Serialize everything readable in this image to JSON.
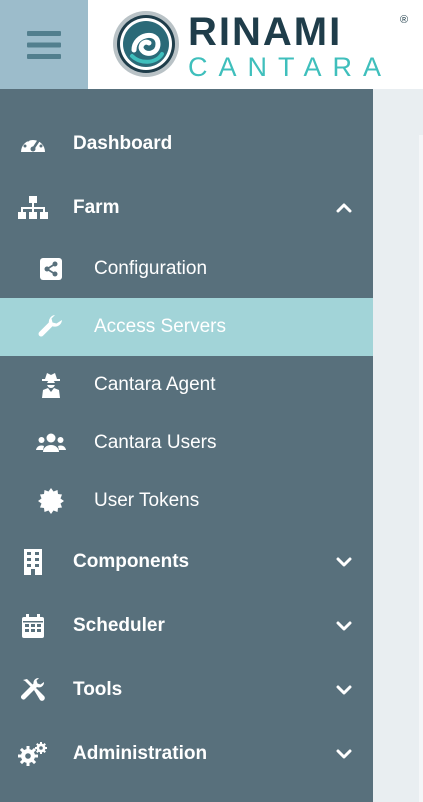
{
  "header": {
    "logo_line1": "RINAMI",
    "logo_reg": "®",
    "logo_line2": "CANTARA"
  },
  "sidebar": {
    "items": [
      {
        "label": "Dashboard",
        "icon": "gauge-icon"
      },
      {
        "label": "Farm",
        "icon": "sitemap-icon",
        "expanded": true
      },
      {
        "label": "Configuration",
        "icon": "share-icon"
      },
      {
        "label": "Access Servers",
        "icon": "wrench-icon",
        "active": true
      },
      {
        "label": "Cantara Agent",
        "icon": "user-secret-icon"
      },
      {
        "label": "Cantara Users",
        "icon": "users-icon"
      },
      {
        "label": "User Tokens",
        "icon": "certificate-icon"
      },
      {
        "label": "Components",
        "icon": "building-icon",
        "expanded": false
      },
      {
        "label": "Scheduler",
        "icon": "calendar-icon",
        "expanded": false
      },
      {
        "label": "Tools",
        "icon": "tools-icon",
        "expanded": false
      },
      {
        "label": "Administration",
        "icon": "cogs-icon",
        "expanded": false
      }
    ]
  },
  "colors": {
    "sidebar_bg": "#58707c",
    "active_bg": "#a2d4d8",
    "hamburger_bg": "#9cbccb",
    "logo_dark": "#1f3d4a",
    "logo_teal": "#3fbfbc"
  }
}
